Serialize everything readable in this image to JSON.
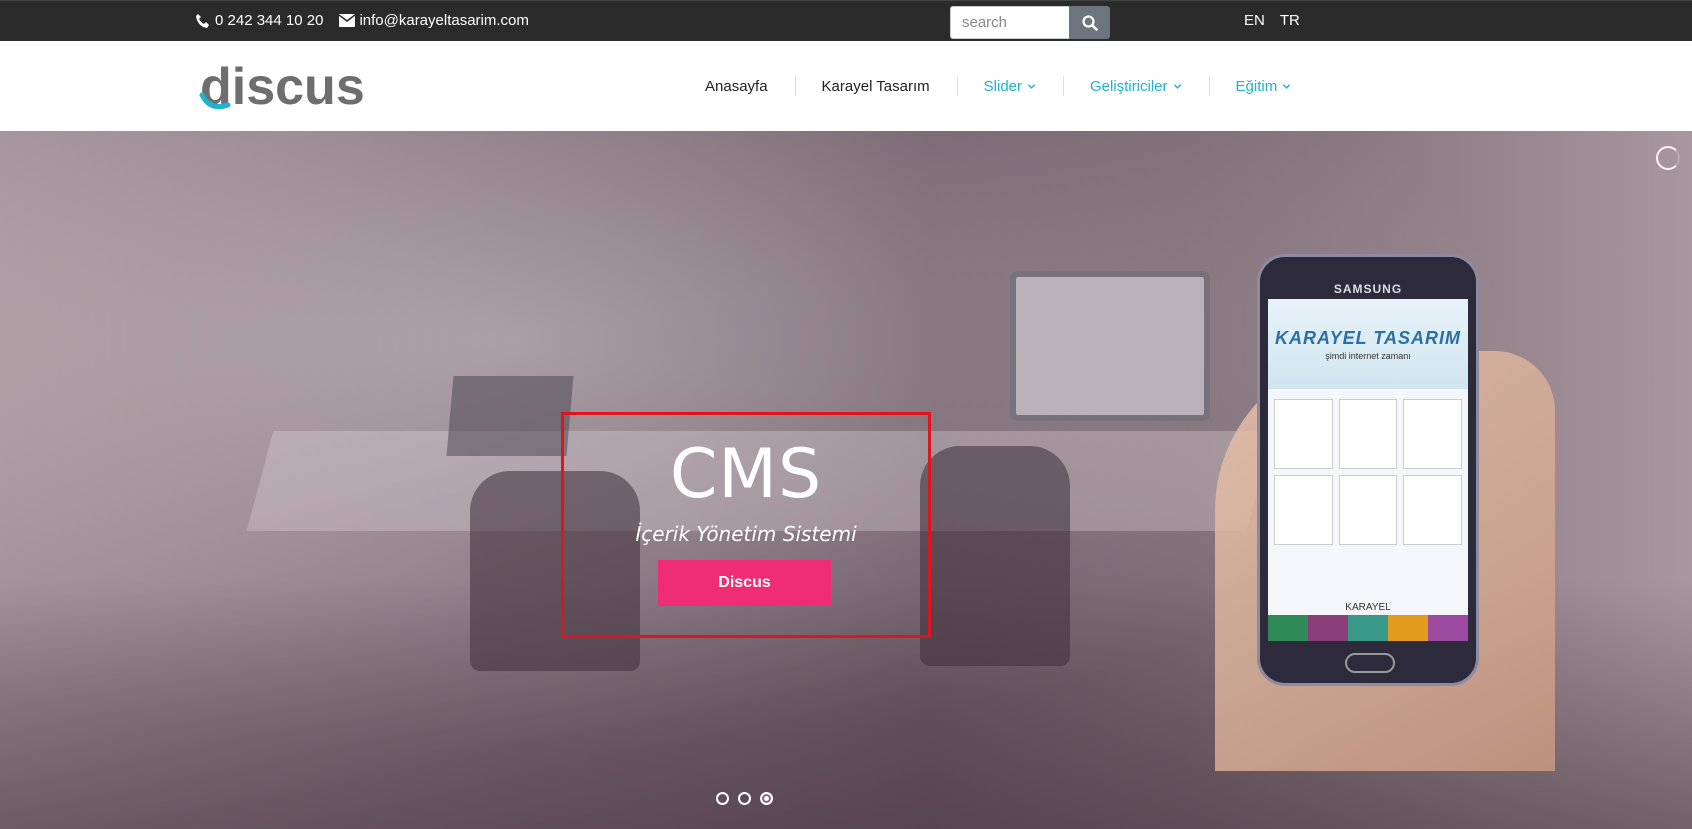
{
  "topbar": {
    "phone": "0 242 344 10 20",
    "email": "info@karayeltasarim.com",
    "search_placeholder": "search",
    "languages": [
      "EN",
      "TR"
    ]
  },
  "navbar": {
    "logo": "discus",
    "menu": [
      {
        "label": "Anasayfa",
        "dropdown": false
      },
      {
        "label": "Karayel Tasarım",
        "dropdown": false
      },
      {
        "label": "Slider",
        "dropdown": true
      },
      {
        "label": "Geliştiriciler",
        "dropdown": true
      },
      {
        "label": "Eğitim",
        "dropdown": true
      }
    ],
    "accent_color": "#1fb3d0"
  },
  "hero": {
    "title": "CMS",
    "subtitle": "İçerik Yönetim Sistemi",
    "button_label": "Discus",
    "button_color": "#ee2d72",
    "slides_count": 3,
    "active_slide": 3,
    "phone_brand": "SAMSUNG",
    "phone_site_logo": "KARAYEL TASARIM",
    "phone_site_tagline": "şimdi internet zamanı",
    "phone_footer": "KARAYEL"
  }
}
